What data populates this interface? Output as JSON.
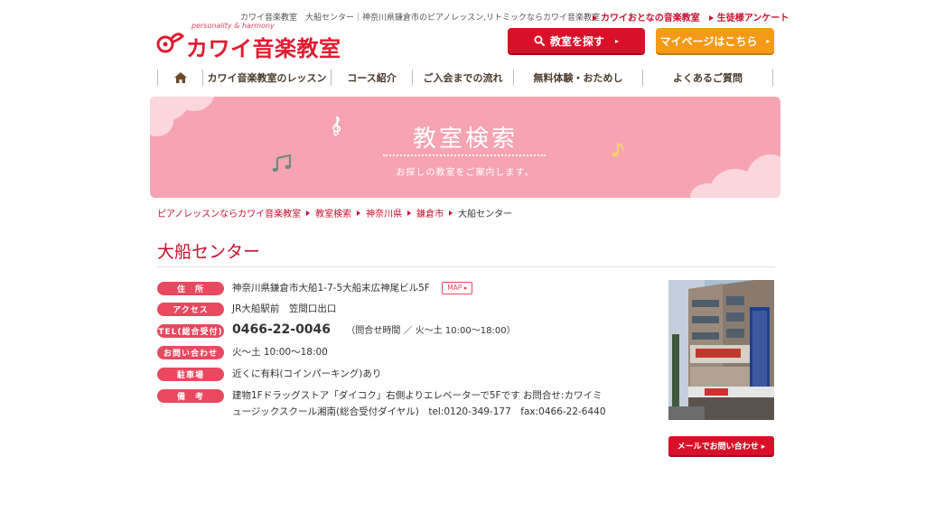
{
  "header": {
    "tagline": "カワイ音楽教室　大船センター｜神奈川県鎌倉市のピアノレッスン,リトミックならカワイ音楽教室",
    "top_links": [
      "カワイおとなの音楽教室",
      "生徒様アンケート"
    ],
    "logo_sub": "personality & harmony",
    "logo_main": "カワイ音楽教室",
    "search_button": "教室を探す",
    "mypage_button": "マイページはこちら"
  },
  "nav": {
    "items": [
      "カワイ音楽教室のレッスン",
      "コース紹介",
      "ご入会までの流れ",
      "無料体験・おためし",
      "よくあるご質問"
    ]
  },
  "banner": {
    "title": "教室検索",
    "subtitle": "お探しの教室をご案内します。"
  },
  "breadcrumb": {
    "links": [
      "ピアノレッスンならカワイ音楽教室",
      "教室検索",
      "神奈川県",
      "鎌倉市"
    ],
    "current": "大船センター"
  },
  "page": {
    "title": "大船センター"
  },
  "info": {
    "address_label": "住　所",
    "address": "神奈川県鎌倉市大船1-7-5大船末広神尾ビル5F",
    "map_button": "MAP ▸",
    "access_label": "アクセス",
    "access": "JR大船駅前　笠間口出口",
    "tel_label": "TEL(総合受付)",
    "tel": "0466-22-0046",
    "tel_note": "（問合せ時間 ／ 火〜土 10:00〜18:00）",
    "inquiry_label": "お問い合わせ",
    "inquiry": "火〜土 10:00〜18:00",
    "parking_label": "駐車場",
    "parking": "近くに有料(コインパーキング)あり",
    "remarks_label": "備　考",
    "remarks_line1": "建物1Fドラッグストア「ダイコク」右側よりエレベーターで5Fです お問合せ:カワイミ",
    "remarks_line2": "ュージックスクール湘南(総合受付ダイヤル)　tel:0120-349-177　fax:0466-22-6440"
  },
  "mail_button": "メールでお問い合わせ ▸",
  "colors": {
    "brand_red": "#d8102a",
    "accent_orange": "#f59a16",
    "banner_pink": "#f6a4b2",
    "label_pink": "#e8495f"
  }
}
